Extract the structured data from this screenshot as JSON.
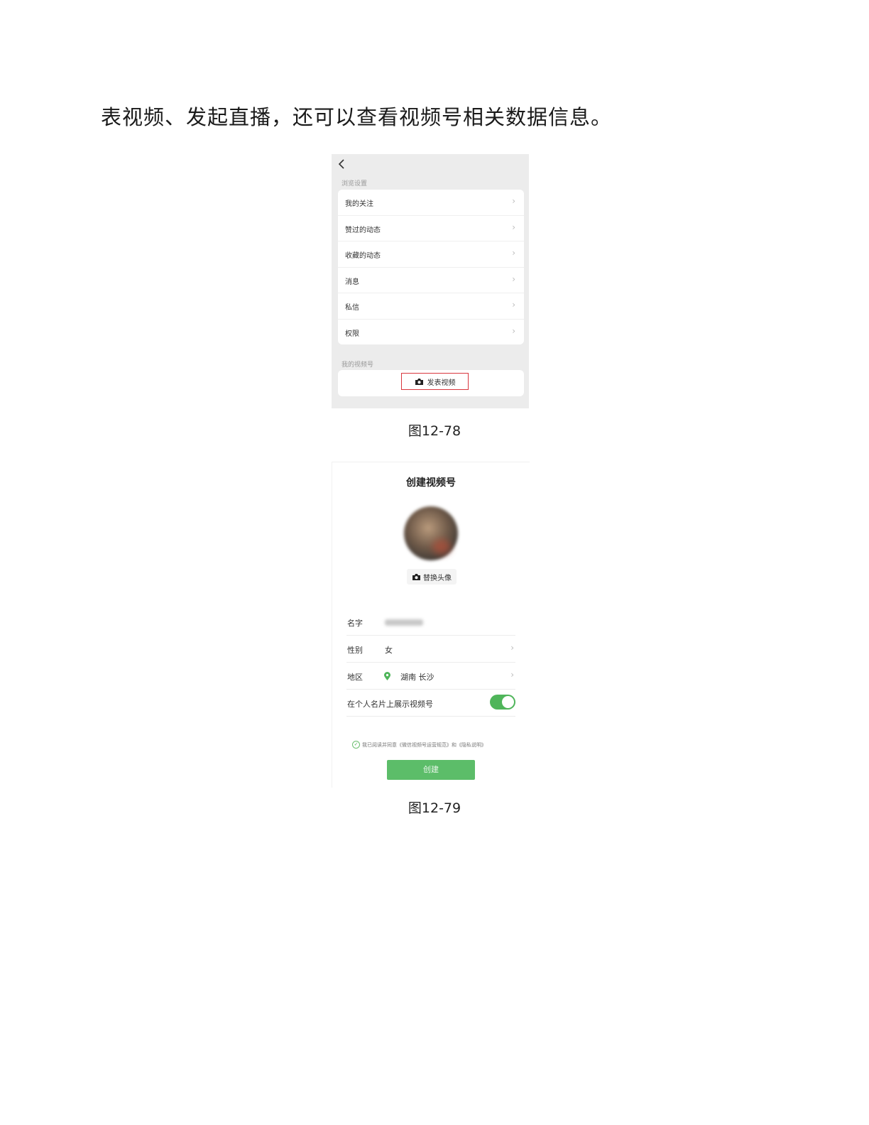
{
  "paragraph": "表视频、发起直播，还可以查看视频号相关数据信息。",
  "figure1": {
    "caption": "图12-78",
    "section_label": "浏览设置",
    "menu_items": [
      {
        "label": "我的关注"
      },
      {
        "label": "赞过的动态"
      },
      {
        "label": "收藏的动态"
      },
      {
        "label": "消息"
      },
      {
        "label": "私信"
      },
      {
        "label": "权限"
      }
    ],
    "channel_section_label": "我的视频号",
    "publish_button": "发表视频",
    "icons": [
      "back-arrow-icon",
      "chevron-right-icon",
      "camera-icon"
    ],
    "highlight_color": "#d9363e"
  },
  "figure2": {
    "caption": "图12-79",
    "title": "创建视频号",
    "replace_avatar_label": "替换头像",
    "fields": {
      "name_label": "名字",
      "gender_label": "性别",
      "gender_value": "女",
      "region_label": "地区",
      "region_value": "湖南 长沙",
      "show_on_card_label": "在个人名片上展示视频号"
    },
    "show_on_card_enabled": true,
    "agreement_text": "我已阅读并同意《微信视频号运营规范》和《隐私说明》",
    "create_button": "创建",
    "accent_color": "#4fb55a"
  }
}
